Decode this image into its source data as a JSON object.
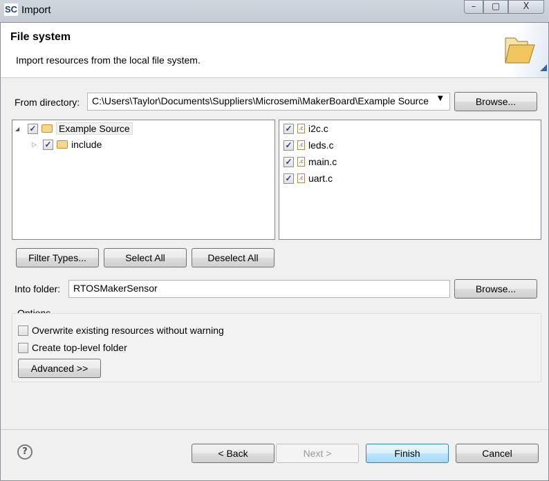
{
  "window": {
    "title": "Import",
    "logo": "SC",
    "minimize_icon": "minimize-icon",
    "maximize_icon": "maximize-icon",
    "close_icon": "close-icon"
  },
  "banner": {
    "title": "File system",
    "description": "Import resources from the local file system.",
    "icon": "folder-open-icon"
  },
  "from_directory": {
    "label": "From directory:",
    "value": "C:\\Users\\Taylor\\Documents\\Suppliers\\Microsemi\\MakerBoard\\Example Source",
    "browse": "Browse..."
  },
  "tree": [
    {
      "label": "Example Source",
      "checked": true,
      "expanded": true
    },
    {
      "label": "include",
      "checked": true,
      "expanded": false
    }
  ],
  "files": [
    {
      "label": "i2c.c",
      "checked": true
    },
    {
      "label": "leds.c",
      "checked": true
    },
    {
      "label": "main.c",
      "checked": true
    },
    {
      "label": "uart.c",
      "checked": true
    }
  ],
  "selection_buttons": {
    "filter": "Filter Types...",
    "select_all": "Select All",
    "deselect_all": "Deselect All"
  },
  "into_folder": {
    "label": "Into folder:",
    "value": "RTOSMakerSensor",
    "browse": "Browse..."
  },
  "options": {
    "title": "Options",
    "overwrite": {
      "label": "Overwrite existing resources without warning",
      "checked": false
    },
    "top_level": {
      "label": "Create top-level folder",
      "checked": false
    },
    "advanced": "Advanced >>"
  },
  "footer": {
    "help": "?",
    "back": "< Back",
    "next": "Next >",
    "finish": "Finish",
    "cancel": "Cancel"
  }
}
